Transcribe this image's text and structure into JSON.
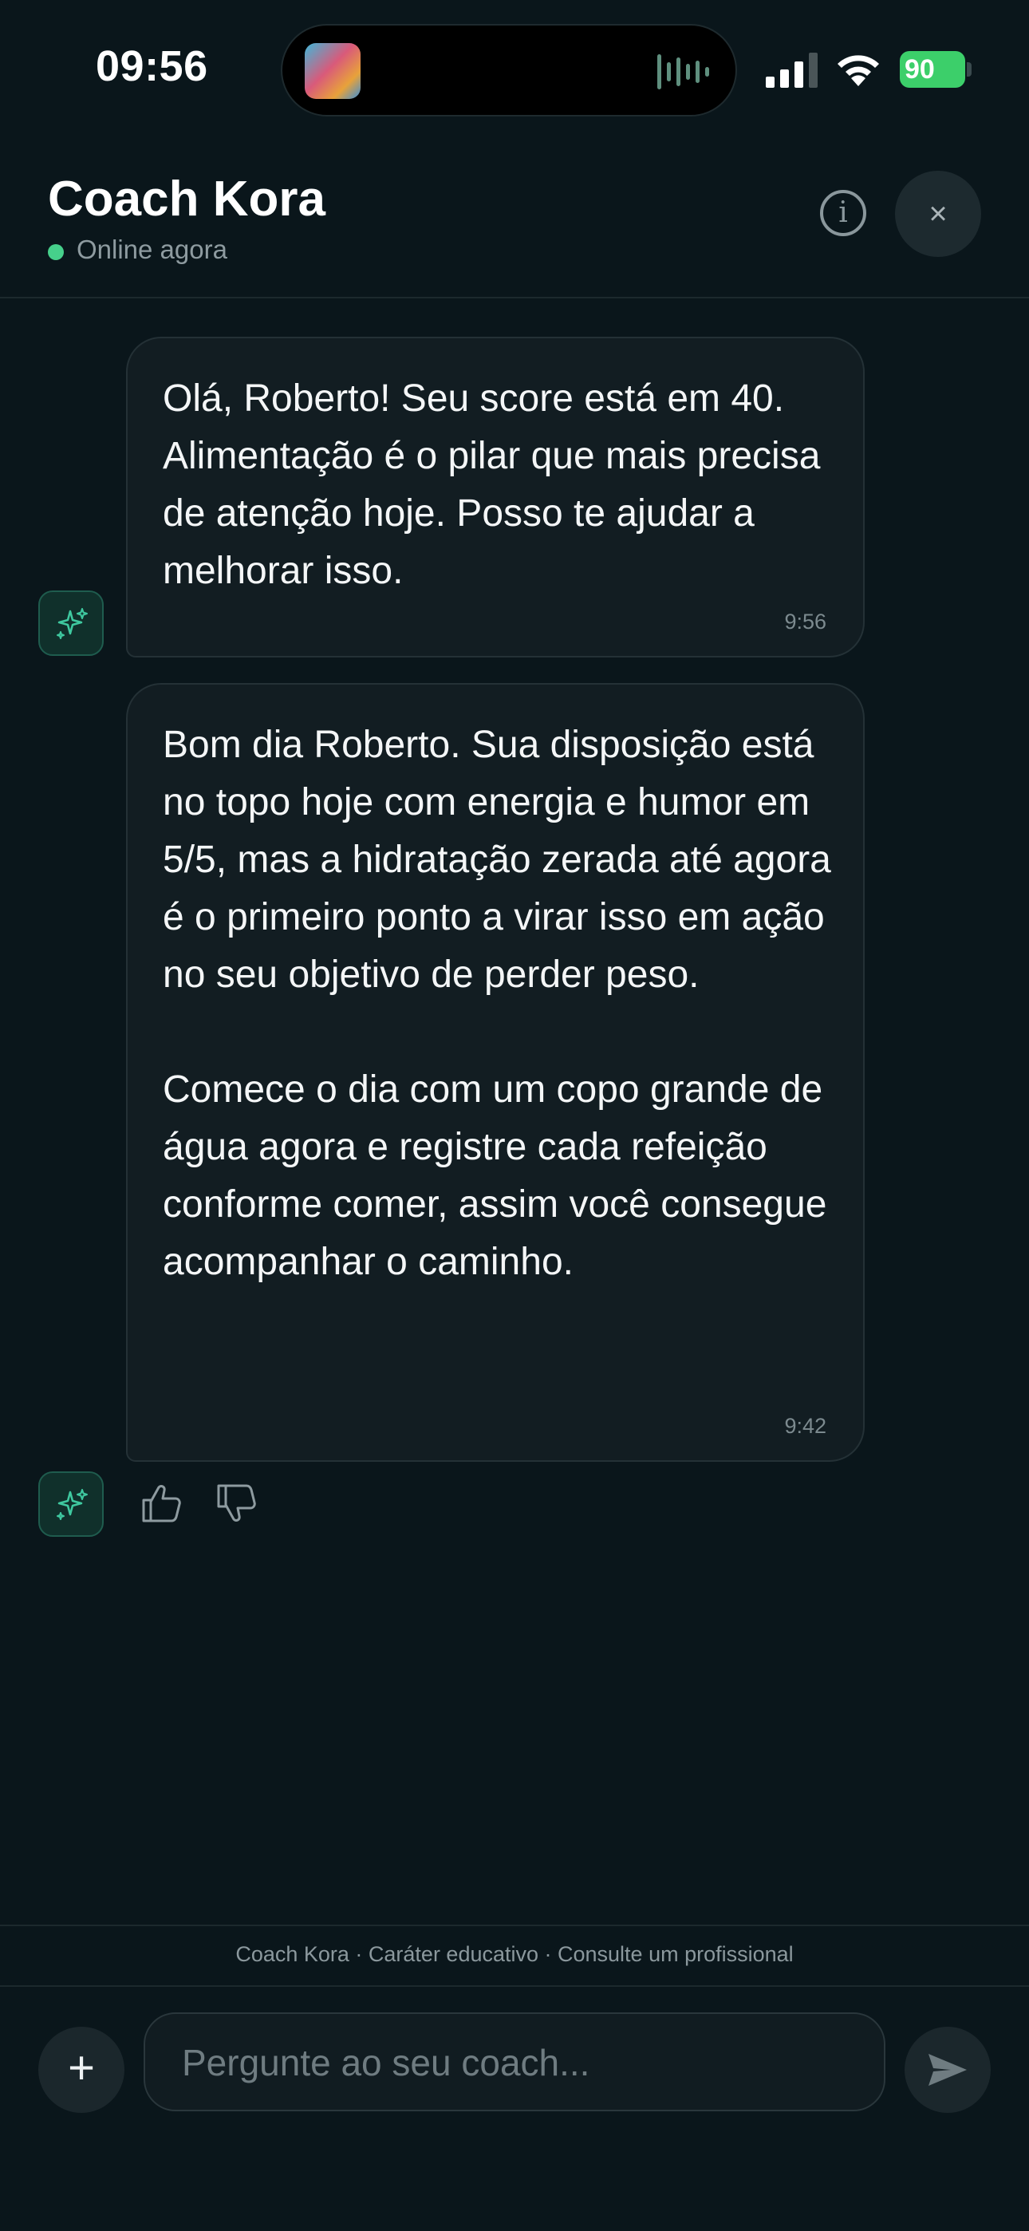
{
  "status_bar": {
    "time": "09:56",
    "battery": "90"
  },
  "header": {
    "title": "Coach Kora",
    "status": "Online agora",
    "status_color": "#46d08b",
    "info_icon": "info-icon",
    "close_icon": "close-icon",
    "close_glyph": "×",
    "info_glyph": "i"
  },
  "messages": [
    {
      "text": "Olá, Roberto! Seu score está em 40. Alimentação é o pilar que mais precisa de atenção hoje. Posso te ajudar a melhorar isso.",
      "time": "9:56"
    },
    {
      "text": "Bom dia Roberto. Sua disposição está no topo hoje com energia e humor em 5/5, mas a hidratação zerada até agora é o primeiro ponto a virar isso em ação no seu objetivo de perder peso.\n\nComece o dia com um copo grande de água agora e registre cada refeição conforme comer, assim você consegue acompanhar o caminho.",
      "time": "9:42"
    }
  ],
  "feedback": {
    "like_icon": "thumbs-up-icon",
    "dislike_icon": "thumbs-down-icon"
  },
  "footer": {
    "disclaimer": "Coach Kora · Caráter educativo · Consulte um profissional",
    "plus_glyph": "+",
    "input_placeholder": "Pergunte ao seu coach...",
    "send_icon": "send-icon"
  },
  "colors": {
    "background": "#0a161b",
    "bubble": "#121d22",
    "accent": "#46d08b",
    "battery": "#3ccf6a"
  }
}
